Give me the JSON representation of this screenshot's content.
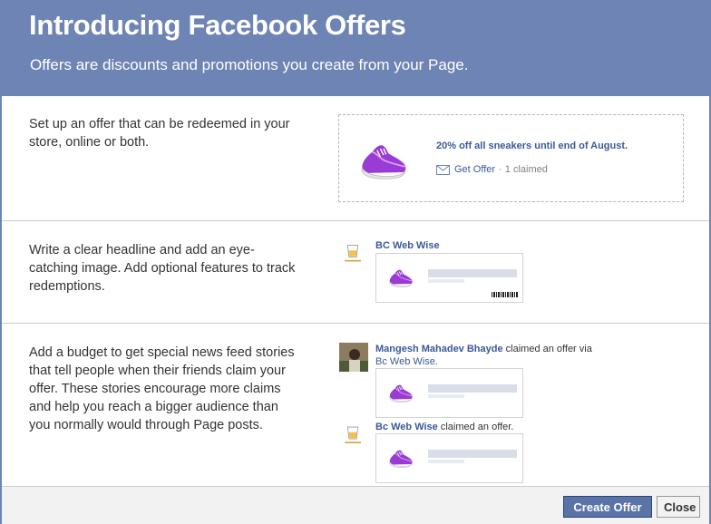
{
  "header": {
    "title": "Introducing Facebook Offers",
    "subtitle": "Offers are discounts and promotions you create from your Page."
  },
  "sections": [
    {
      "description": "Set up an offer that can be redeemed in your store, online or both."
    },
    {
      "description": "Write a clear headline and add an eye-catching image. Add optional features to track redemptions."
    },
    {
      "description": "Add a budget to get special news feed stories that tell people when their friends claim your offer. These stories encourage more claims and help you reach a bigger audience than you normally would through Page posts."
    }
  ],
  "offer_preview": {
    "title": "20% off all sneakers until end of August.",
    "get_offer_label": "Get Offer",
    "claimed_text": "· 1 claimed"
  },
  "page_preview": {
    "page_name": "BC Web Wise"
  },
  "stories": {
    "friend_name": "Mangesh Mahadev Bhayde",
    "friend_action": "claimed an offer via",
    "via_page": "Bc Web Wise.",
    "page_name": "Bc Web Wise",
    "page_action": "claimed an offer."
  },
  "footer": {
    "create_label": "Create Offer",
    "close_label": "Close"
  },
  "colors": {
    "header_bg": "#6d84b4",
    "link": "#3b5998",
    "primary_button": "#5b74a8",
    "shoe_purple": "#9b3bd6"
  },
  "icons": [
    "sneaker-icon",
    "mail-icon",
    "page-logo-icon",
    "user-avatar",
    "barcode-icon"
  ]
}
